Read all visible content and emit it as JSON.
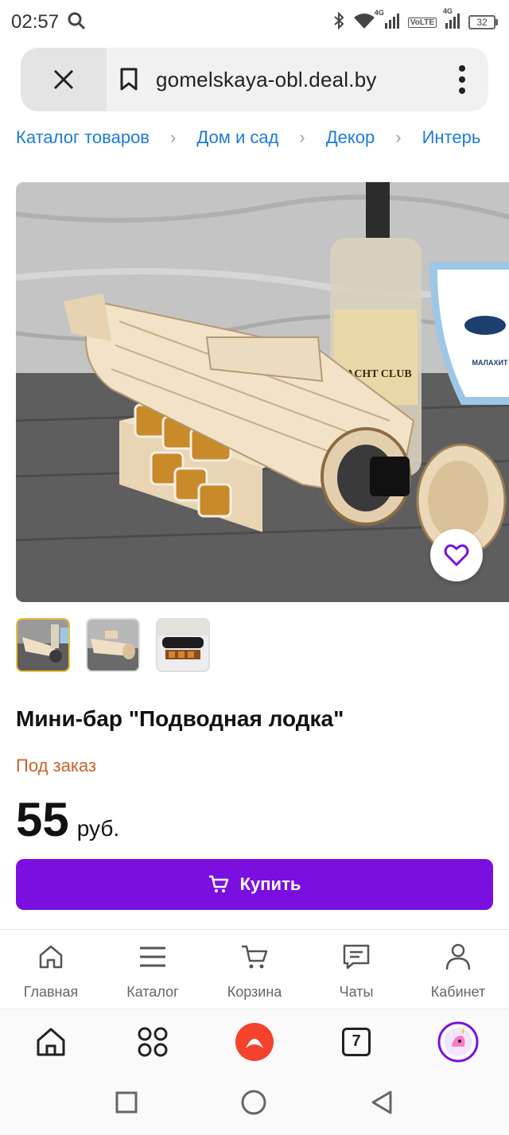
{
  "status_bar": {
    "time": "02:57",
    "network_1": "4G",
    "volte": "VoLTE",
    "network_2": "4G",
    "battery": "32"
  },
  "browser": {
    "host": "gomelskaya-obl.deal.by",
    "tabs_count": "7"
  },
  "breadcrumb": [
    "Каталог товаров",
    "Дом и сад",
    "Декор",
    "Интерь"
  ],
  "product": {
    "title": "Мини-бар \"Подводная лодка\"",
    "availability": "Под заказ",
    "price": "55",
    "currency": "руб.",
    "buy_label": "Купить",
    "image_labels": {
      "bottle_brand": "YACHT CLUB",
      "pennant_brand": "МАЛАХИТ"
    },
    "thumbnail_count": 3
  },
  "site_nav": [
    {
      "label": "Главная",
      "icon": "home-icon"
    },
    {
      "label": "Каталог",
      "icon": "menu-icon"
    },
    {
      "label": "Корзина",
      "icon": "cart-icon"
    },
    {
      "label": "Чаты",
      "icon": "chat-icon"
    },
    {
      "label": "Кабинет",
      "icon": "user-icon"
    }
  ],
  "colors": {
    "accent": "#7a0fe0",
    "link": "#1e7ad6",
    "availability": "#c8622c"
  }
}
